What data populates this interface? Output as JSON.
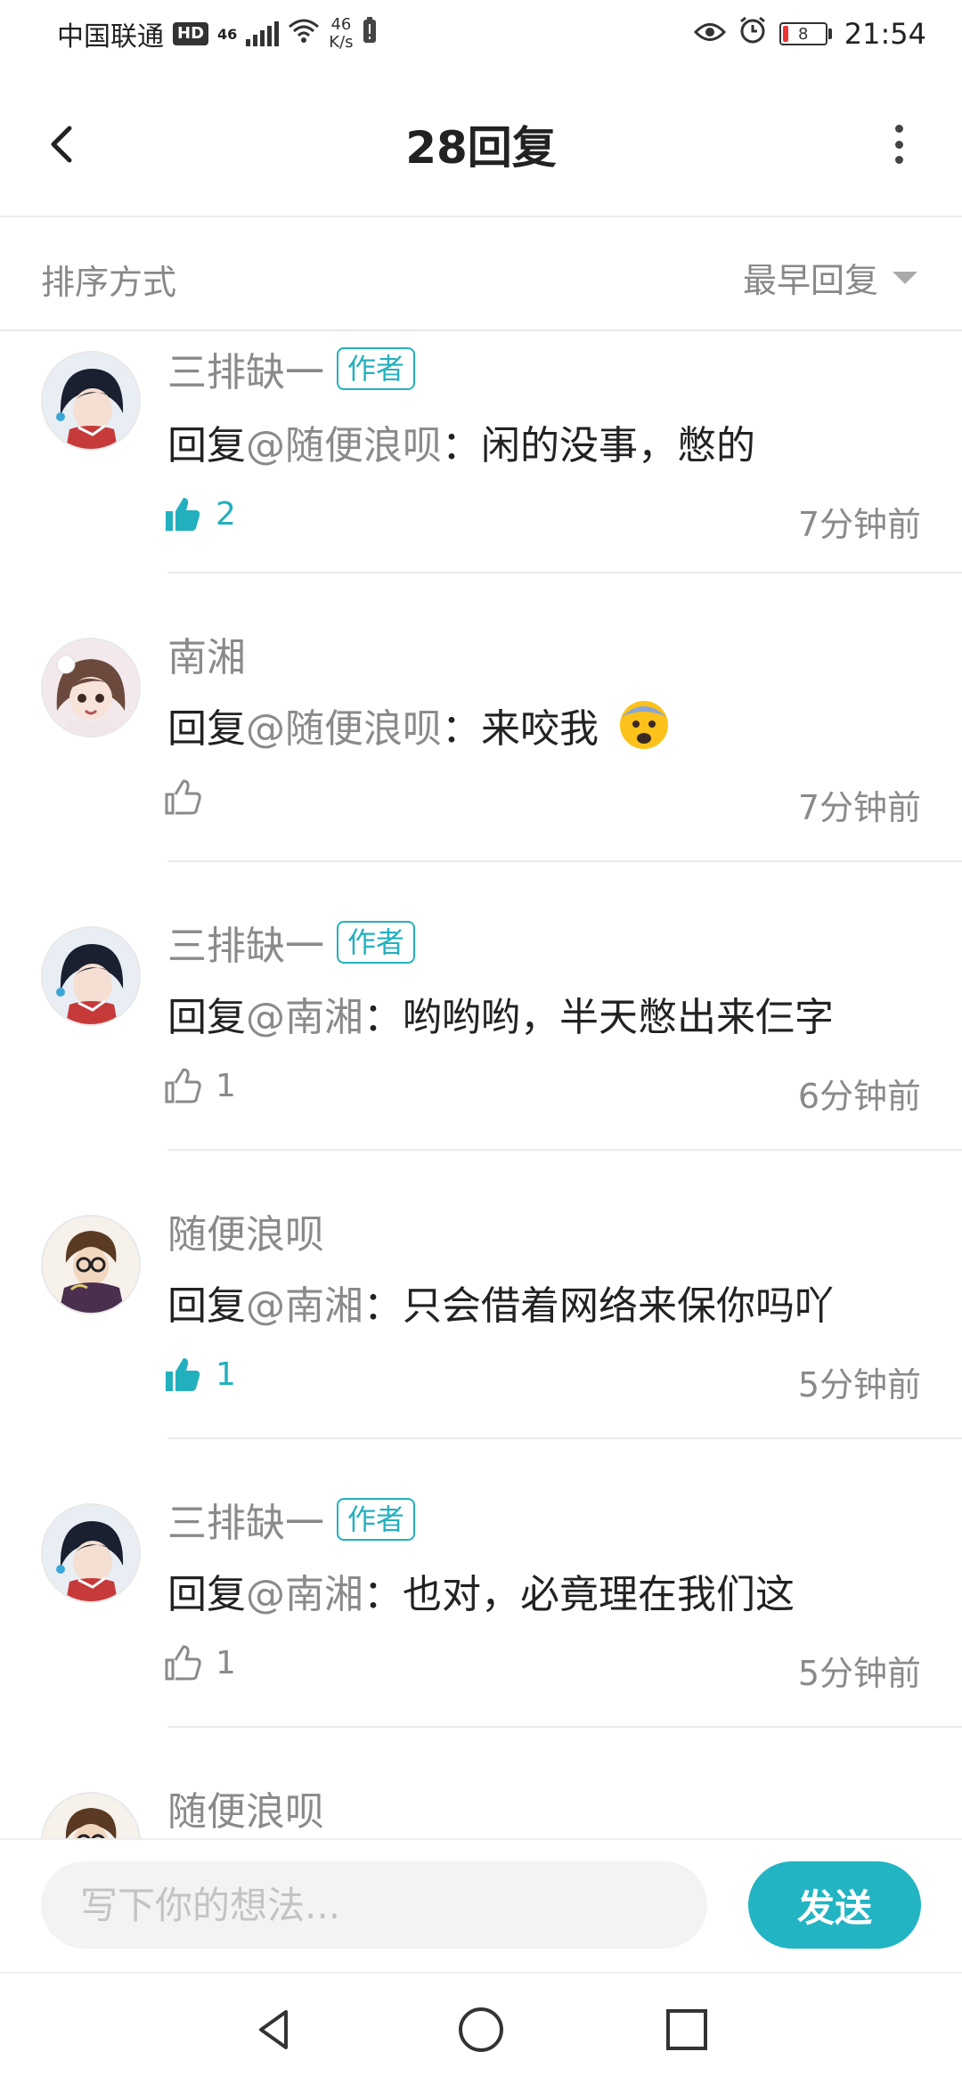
{
  "status_bar": {
    "carrier": "中国联通",
    "hd": "HD",
    "network": "46",
    "speed_value": "46",
    "speed_unit": "K/s",
    "battery": "8",
    "time": "21:54"
  },
  "header": {
    "title": "28回复",
    "back_icon": "chevron-left-icon",
    "more_icon": "more-vertical-icon"
  },
  "sort": {
    "label": "排序方式",
    "selected": "最早回复"
  },
  "comments": [
    {
      "name": "三排缺一",
      "is_author": true,
      "author_badge": "作者",
      "reply_prefix": "回复",
      "reply_to": "@随便浪呗",
      "text": "：闲的没事，憋的",
      "likes": "2",
      "liked": true,
      "time": "7分钟前",
      "avatar": "avatar-dark-hair"
    },
    {
      "name": "南湘",
      "is_author": false,
      "reply_prefix": "回复",
      "reply_to": "@随便浪呗",
      "text": "：来咬我",
      "emoji": "fearful-face-emoji",
      "likes": "",
      "liked": false,
      "time": "7分钟前",
      "avatar": "avatar-brown-hair"
    },
    {
      "name": "三排缺一",
      "is_author": true,
      "author_badge": "作者",
      "reply_prefix": "回复",
      "reply_to": "@南湘",
      "text": "：哟哟哟，半天憋出来仨字",
      "likes": "1",
      "liked": false,
      "time": "6分钟前",
      "avatar": "avatar-dark-hair"
    },
    {
      "name": "随便浪呗",
      "is_author": false,
      "reply_prefix": "回复",
      "reply_to": "@南湘",
      "text": "：只会借着网络来保你吗吖",
      "likes": "1",
      "liked": true,
      "time": "5分钟前",
      "avatar": "avatar-glasses"
    },
    {
      "name": "三排缺一",
      "is_author": true,
      "author_badge": "作者",
      "reply_prefix": "回复",
      "reply_to": "@南湘",
      "text": "：也对，必竟理在我们这",
      "likes": "1",
      "liked": false,
      "time": "5分钟前",
      "avatar": "avatar-dark-hair"
    },
    {
      "name": "随便浪呗",
      "is_author": false,
      "avatar": "avatar-glasses"
    }
  ],
  "input": {
    "placeholder": "写下你的想法...",
    "send_label": "发送"
  },
  "colors": {
    "accent": "#22b4c3",
    "muted_text": "#8a8a8a",
    "divider": "#ebebeb"
  }
}
